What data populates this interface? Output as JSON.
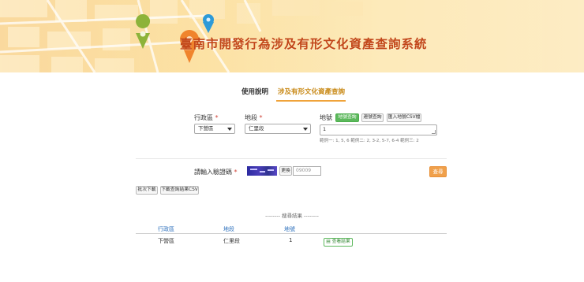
{
  "banner": {
    "title": "臺南市開發行為涉及有形文化資產查詢系統",
    "pin_colors": [
      "#8db33a",
      "#f0842c",
      "#2c9ad8"
    ]
  },
  "tabs": [
    {
      "label": "使用說明",
      "active": false
    },
    {
      "label": "涉及有形文化資產查詢",
      "active": true
    }
  ],
  "form": {
    "district": {
      "label": "行政區",
      "value": "下營區"
    },
    "section": {
      "label": "地段",
      "value": "仁里段"
    },
    "parcel": {
      "label": "地號",
      "buttons": [
        "地號查詢",
        "連號查詢",
        "匯入地號CSV檔"
      ],
      "value": "1",
      "hint": "範例一: 1, 5, 6    範例二: 2, 3-2, 5-7, 6-4    範例三: 2"
    },
    "captcha": {
      "label": "請輸入驗證碼",
      "refresh_label": "更換",
      "placeholder": "09009"
    },
    "query_label": "查尋",
    "export_buttons": [
      "批次下載",
      "下載查詢結果CSV"
    ]
  },
  "results": {
    "title": "-------- 搜尋結果 --------",
    "columns": [
      "行政區",
      "地段",
      "地號"
    ],
    "rows": [
      {
        "district": "下營區",
        "section": "仁里段",
        "parcel": "1",
        "action": "查看結果"
      }
    ]
  },
  "colors": {
    "title": "#c2471a",
    "tab_accent": "#f0a33a",
    "primary_green": "#5cb85c",
    "query_orange": "#f0a04b",
    "link_blue": "#2a6ebb"
  }
}
